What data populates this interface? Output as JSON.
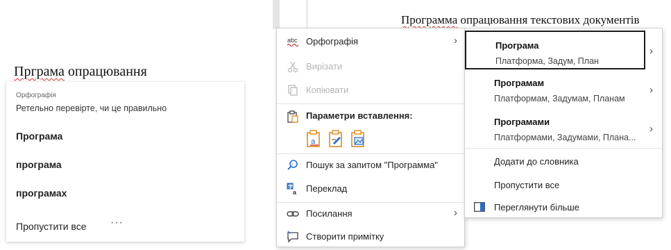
{
  "left_panel": {
    "doc_text_word": "Прграма",
    "doc_text_rest": " опрацювання",
    "card": {
      "category": "Орфографія",
      "description": "Ретельно перевірте, чи це правильно",
      "suggestions": [
        "Програма",
        "програма",
        "програмах"
      ],
      "ignore_all": "Пропустити все",
      "more": "···"
    }
  },
  "document": {
    "text_word": "Программа",
    "text_rest": " опрацювання текстових документів"
  },
  "context_menu": {
    "spelling": {
      "label": "Орфографія",
      "icon": "abc-spelling-icon"
    },
    "cut": {
      "label": "Вирізати",
      "icon": "scissors-icon"
    },
    "copy": {
      "label": "Копіювати",
      "icon": "copy-icon"
    },
    "paste_options": {
      "label": "Параметри вставлення:",
      "icon": "clipboard-icon"
    },
    "search": {
      "label": "Пошук за запитом \"Программа\"",
      "icon": "search-icon"
    },
    "translate": {
      "label": "Переклад",
      "icon": "translate-icon"
    },
    "link": {
      "label": "Посилання",
      "icon": "link-icon"
    },
    "comment": {
      "label": "Створити примітку",
      "icon": "comment-icon"
    }
  },
  "spelling_submenu": {
    "suggestions": [
      {
        "word": "Програма",
        "synonyms": "Платформа, Задум, План"
      },
      {
        "word": "Програмам",
        "synonyms": "Платформам, Задумам, Планам"
      },
      {
        "word": "Програмами",
        "synonyms": "Платформами, Задумами, Плана..."
      }
    ],
    "add_to_dictionary": "Додати до словника",
    "ignore_all": "Пропустити все",
    "see_more": "Переглянути більше"
  },
  "colors": {
    "squiggle": "#d23a32",
    "icon_blue": "#2b6cc4",
    "icon_orange": "#e08a1e",
    "selected_border": "#1a1a1a"
  }
}
